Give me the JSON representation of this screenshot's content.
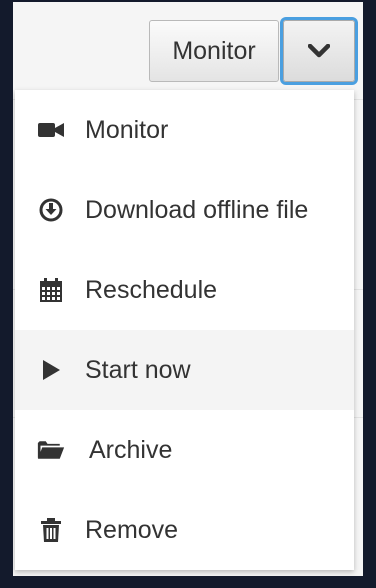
{
  "toolbar": {
    "main_label": "Monitor",
    "toggle_icon": "chevron-down-icon"
  },
  "menu": {
    "items": [
      {
        "label": "Monitor",
        "icon": "video-camera-icon"
      },
      {
        "label": "Download offline file",
        "icon": "download-icon"
      },
      {
        "label": "Reschedule",
        "icon": "calendar-icon"
      },
      {
        "label": "Start now",
        "icon": "play-icon",
        "highlighted": true
      },
      {
        "label": "Archive",
        "icon": "folder-open-icon"
      },
      {
        "label": "Remove",
        "icon": "trash-icon"
      }
    ]
  },
  "colors": {
    "background": "#131a2c",
    "focus_ring": "#4a9fe0",
    "text": "#333333",
    "highlight": "#f4f4f4"
  }
}
